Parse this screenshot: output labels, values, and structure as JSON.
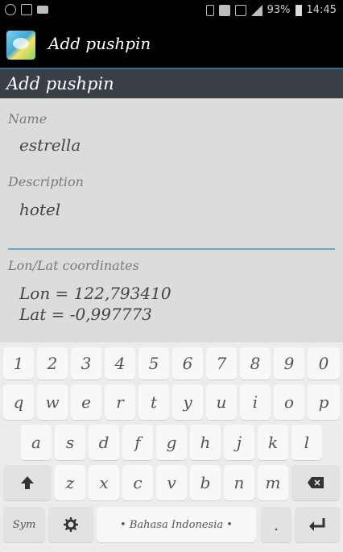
{
  "status_bar": {
    "battery": "93%",
    "time": "14:45"
  },
  "action_bar": {
    "title": "Add pushpin"
  },
  "dialog": {
    "title": "Add pushpin",
    "name_label": "Name",
    "name_value": "estrella",
    "description_label": "Description",
    "description_value": "hotel",
    "coords_label": "Lon/Lat coordinates",
    "lon": "Lon = 122,793410",
    "lat": "Lat = -0,997773"
  },
  "keyboard": {
    "row1": [
      "1",
      "2",
      "3",
      "4",
      "5",
      "6",
      "7",
      "8",
      "9",
      "0"
    ],
    "row2": [
      "q",
      "w",
      "e",
      "r",
      "t",
      "y",
      "u",
      "i",
      "o",
      "p"
    ],
    "row3": [
      "a",
      "s",
      "d",
      "f",
      "g",
      "h",
      "j",
      "k",
      "l"
    ],
    "row4": [
      "z",
      "x",
      "c",
      "v",
      "b",
      "n",
      "m"
    ],
    "sym_label": "Sym",
    "space_label": "• Bahasa Indonesia •",
    "period_label": "."
  }
}
